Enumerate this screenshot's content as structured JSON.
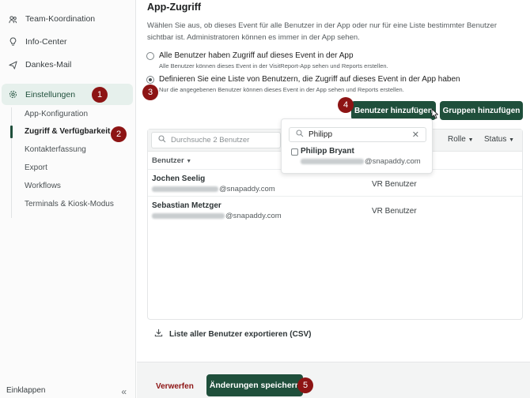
{
  "sidebar": {
    "items": [
      {
        "label": "Team-Koordination",
        "icon": "team-icon"
      },
      {
        "label": "Info-Center",
        "icon": "lightbulb-icon"
      },
      {
        "label": "Dankes-Mail",
        "icon": "send-icon"
      },
      {
        "label": "Einstellungen",
        "icon": "gear-icon",
        "active": true
      }
    ],
    "sub_items": [
      {
        "label": "App-Konfiguration"
      },
      {
        "label": "Zugriff & Verfügbarkeit",
        "active": true
      },
      {
        "label": "Kontakterfassung"
      },
      {
        "label": "Export"
      },
      {
        "label": "Workflows"
      },
      {
        "label": "Terminals & Kiosk-Modus"
      }
    ],
    "collapse_label": "Einklappen",
    "collapse_icon": "double-chevron-left-icon"
  },
  "main": {
    "title": "App-Zugriff",
    "description": "Wählen Sie aus, ob dieses Event für alle Benutzer in der App oder nur für eine Liste bestimmter Benutzer sichtbar ist. Administratoren können es immer in der App sehen.",
    "options": [
      {
        "label": "Alle Benutzer haben Zugriff auf dieses Event in der App",
        "help": "Alle Benutzer können dieses Event in der VisitReport-App sehen und Reports erstellen.",
        "selected": false
      },
      {
        "label": "Definieren Sie eine Liste von Benutzern, die Zugriff auf dieses Event in der App haben",
        "help": "Nur die angegebenen Benutzer können dieses Event in der App sehen und Reports erstellen.",
        "selected": true
      }
    ],
    "add_user_button": "Benutzer hinzufügen",
    "add_group_button": "Gruppen hinzufügen",
    "table": {
      "search_placeholder": "Durchsuche 2 Benutzer",
      "filters": [
        "Rolle",
        "Status"
      ],
      "column_header": "Benutzer",
      "rows": [
        {
          "name": "Jochen Seelig",
          "email_domain": "@snapaddy.com",
          "role": "VR Benutzer"
        },
        {
          "name": "Sebastian Metzger",
          "email_domain": "@snapaddy.com",
          "role": "VR Benutzer"
        }
      ]
    },
    "dropdown": {
      "search_value": "Philipp",
      "results": [
        {
          "name": "Philipp Bryant",
          "email_domain": "@snapaddy.com",
          "checked": false
        }
      ]
    },
    "export_label": "Liste aller Benutzer exportieren (CSV)"
  },
  "footer": {
    "discard_label": "Verwerfen",
    "save_label": "Änderungen speichern"
  },
  "badges": [
    "1",
    "2",
    "3",
    "4",
    "5"
  ],
  "colors": {
    "accent": "#1f4f3b",
    "badge": "#8d1414",
    "active_bg": "#e6f0ec"
  }
}
